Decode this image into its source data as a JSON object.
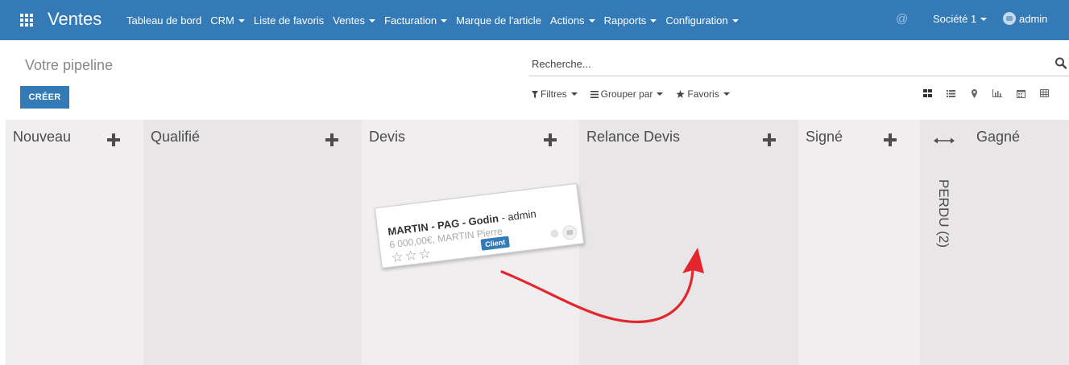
{
  "navbar": {
    "brand": "Ventes",
    "menu": [
      {
        "label": "Tableau de bord",
        "dropdown": false
      },
      {
        "label": "CRM",
        "dropdown": true
      },
      {
        "label": "Liste de favoris",
        "dropdown": false
      },
      {
        "label": "Ventes",
        "dropdown": true
      },
      {
        "label": "Facturation",
        "dropdown": true
      },
      {
        "label": "Marque de l'article",
        "dropdown": false
      },
      {
        "label": "Actions",
        "dropdown": true
      },
      {
        "label": "Rapports",
        "dropdown": true
      },
      {
        "label": "Configuration",
        "dropdown": true
      }
    ],
    "at_symbol": "@",
    "company": "Société 1",
    "user": "admin",
    "color": "#337ab7"
  },
  "control_panel": {
    "breadcrumb": "Votre pipeline",
    "create_label": "CRÉER",
    "search_placeholder": "Recherche...",
    "filters_label": "Filtres",
    "group_by_label": "Grouper par",
    "favorites_label": "Favoris",
    "views": [
      "kanban-icon",
      "list-icon",
      "map-marker-icon",
      "graph-icon",
      "calendar-icon",
      "pivot-icon"
    ]
  },
  "kanban": {
    "columns": [
      {
        "title": "Nouveau"
      },
      {
        "title": "Qualifié"
      },
      {
        "title": "Devis"
      },
      {
        "title": "Relance Devis"
      },
      {
        "title": "Signé"
      },
      {
        "title": "Gagné"
      }
    ],
    "folded_column": {
      "label": "PERDU (2)"
    },
    "card": {
      "title_bold": "MARTIN - PAG - Godin",
      "title_rest": " - admin",
      "subtitle": "6 000,00€, MARTIN Pierre",
      "stars": "☆☆☆",
      "badge": "Client",
      "badge_color": "#337ab7"
    }
  },
  "annotation": {
    "arrow_color": "#e3262e"
  }
}
